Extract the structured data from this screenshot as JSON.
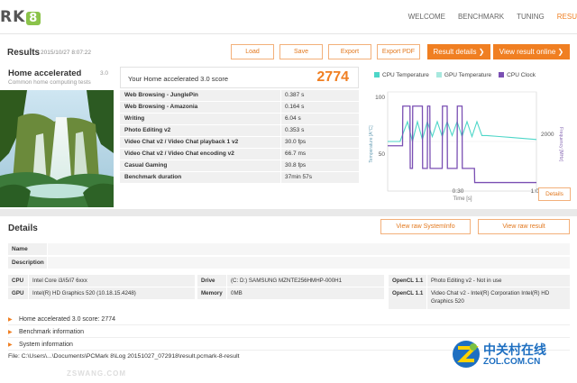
{
  "header": {
    "logo_text": "RK",
    "logo_badge": "8",
    "nav": [
      "WELCOME",
      "BENCHMARK",
      "TUNING",
      "RESU"
    ]
  },
  "results_bar": {
    "title": "Results",
    "date": "2015/10/27 8:07:22",
    "buttons": [
      "Load",
      "Save",
      "Export",
      "Export PDF"
    ],
    "result_details": "Result details ❯",
    "view_online": "View result online ❯"
  },
  "benchmark": {
    "name": "Home accelerated",
    "version": "3.0",
    "subtitle": "Common home computing tests"
  },
  "score": {
    "label": "Your Home accelerated 3.0 score",
    "value": "2774",
    "rows": [
      {
        "name": "Web Browsing - JunglePin",
        "value": "0.387 s"
      },
      {
        "name": "Web Browsing - Amazonia",
        "value": "0.164 s"
      },
      {
        "name": "Writing",
        "value": "6.04 s"
      },
      {
        "name": "Photo Editing v2",
        "value": "0.353 s"
      },
      {
        "name": "Video Chat v2 / Video Chat playback 1 v2",
        "value": "30.0 fps"
      },
      {
        "name": "Video Chat v2 / Video Chat encoding v2",
        "value": "66.7 ms"
      },
      {
        "name": "Casual Gaming",
        "value": "30.8 fps"
      },
      {
        "name": "Benchmark duration",
        "value": "37min 57s"
      }
    ]
  },
  "chart_data": {
    "type": "line",
    "legend": [
      "CPU Temperature",
      "GPU Temperature",
      "CPU Clock"
    ],
    "colors": {
      "cpu_temp": "#4dd6c8",
      "gpu_temp": "#a7e8de",
      "cpu_clock": "#7a4fb3"
    },
    "xlabel": "Time [s]",
    "ylabel_left": "Temperature [A°C]",
    "ylabel_right": "Frequency [MHz]",
    "x_ticks": [
      "0:30",
      "1:00"
    ],
    "y_left_ticks": [
      "100",
      "50"
    ],
    "y_right_ticks": [
      "2000",
      "0"
    ],
    "xlim": [
      0,
      60
    ],
    "ylim_left": [
      0,
      100
    ],
    "ylim_right": [
      0,
      3500
    ],
    "series": [
      {
        "name": "CPU Temperature",
        "x": [
          0,
          5,
          8,
          10,
          12,
          14,
          16,
          18,
          20,
          22,
          24,
          26,
          28,
          30,
          32,
          34,
          36,
          38,
          40,
          45,
          50,
          55,
          60
        ],
        "values": [
          50,
          50,
          70,
          50,
          70,
          52,
          70,
          55,
          70,
          55,
          70,
          56,
          70,
          55,
          70,
          55,
          70,
          56,
          56,
          55,
          54,
          53,
          52
        ]
      },
      {
        "name": "CPU Clock",
        "x": [
          0,
          6,
          6.1,
          9,
          9.1,
          10,
          10.1,
          14,
          14.1,
          16,
          16.1,
          17,
          17.1,
          22,
          22.1,
          24,
          24.1,
          28,
          28.1,
          30,
          30.1,
          35,
          35.1,
          60
        ],
        "values": [
          1600,
          1600,
          3000,
          3000,
          800,
          800,
          3000,
          3000,
          800,
          800,
          3000,
          3000,
          800,
          800,
          3000,
          3000,
          800,
          800,
          3000,
          3000,
          800,
          800,
          300,
          300
        ]
      }
    ]
  },
  "chart_ui": {
    "details_label": "Details"
  },
  "details": {
    "title": "Details",
    "view_sysinfo": "View raw SystemInfo",
    "view_result": "View raw result",
    "name_label": "Name",
    "desc_label": "Description",
    "cpu_label": "CPU",
    "cpu_value": "Intel Core i3/i5/i7 6xxx",
    "gpu_label": "GPU",
    "gpu_value": "Intel(R) HD Graphics 520 (10.18.15.4248)",
    "drive_label": "Drive",
    "drive_value": "(C: D:) SAMSUNG MZNTE256HMHP-000H1",
    "memory_label": "Memory",
    "memory_value": "0MB",
    "opencl1_label": "OpenCL 1.1",
    "opencl1_value": "Photo Editing v2 - Not in use",
    "opencl2_label": "OpenCL 1.1",
    "opencl2_value": "Video Chat v2 - Intel(R) Corporation Intel(R) HD Graphics 520",
    "sections": [
      "Home accelerated 3.0 score: 2774",
      "Benchmark information",
      "System information"
    ],
    "file_line": "File: C:\\Users\\...\\Documents\\PCMark 8\\Log 20151027_072918\\result.pcmark-8-result"
  },
  "watermark": {
    "cn": "中关村在线",
    "en": "ZOL.COM.CN",
    "site": "ZSWANG.COM"
  }
}
